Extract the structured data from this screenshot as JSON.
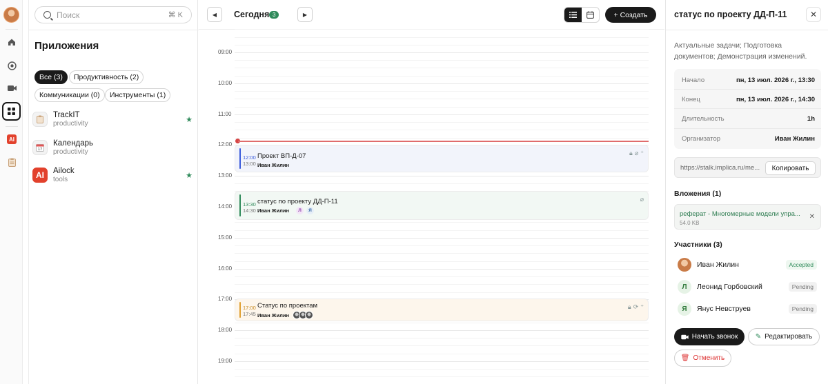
{
  "search": {
    "placeholder": "Поиск",
    "shortcut": "⌘ K"
  },
  "apps": {
    "title": "Приложения",
    "filters": [
      "Все (3)",
      "Продуктивность (2)",
      "Коммуникации (0)",
      "Инструменты (1)"
    ],
    "items": [
      {
        "name": "TrackIT",
        "category": "productivity",
        "icon": "clipboard-icon",
        "starred": true
      },
      {
        "name": "Календарь",
        "category": "productivity",
        "icon": "calendar-icon",
        "starred": false
      },
      {
        "name": "Ailock",
        "category": "tools",
        "icon": "ai-logo-icon",
        "starred": true
      }
    ]
  },
  "calendar": {
    "day_label": "Сегодня",
    "count": "3",
    "create_label": "+ Создать",
    "hours": [
      "09:00",
      "10:00",
      "11:00",
      "12:00",
      "13:00",
      "14:00",
      "15:00",
      "16:00",
      "17:00",
      "18:00",
      "19:00"
    ],
    "events": [
      {
        "start": "12:00",
        "end": "13:00",
        "title": "Проект ВП-Д-07",
        "organizer": "Иван Жилин",
        "color": "#3b5bdb"
      },
      {
        "start": "13:30",
        "end": "14:30",
        "title": "статус по проекту ДД-П-11",
        "organizer": "Иван Жилин",
        "participants": [
          "Л",
          "Я"
        ],
        "color": "#2f8a5a"
      },
      {
        "start": "17:00",
        "end": "17:45",
        "title": "Статус по проектам",
        "organizer": "Иван Жилин",
        "color": "#e0a030"
      }
    ]
  },
  "details": {
    "title": "статус по проекту ДД-П-11",
    "description": "Актуальные задачи; Подготовка документов; Демонстрация изменений.",
    "rows": [
      {
        "k": "Начало",
        "v": "пн, 13 июл. 2026 г., 13:30"
      },
      {
        "k": "Конец",
        "v": "пн, 13 июл. 2026 г., 14:30"
      },
      {
        "k": "Длительность",
        "v": "1h"
      },
      {
        "k": "Организатор",
        "v": "Иван Жилин"
      }
    ],
    "link": "https://stalk.implica.ru/me...",
    "copy_label": "Копировать",
    "attachments_title": "Вложения (1)",
    "attachment": {
      "name": "реферат - Многомерные модели упра...",
      "size": "54.0 KB"
    },
    "participants_title": "Участники (3)",
    "participants": [
      {
        "name": "Иван Жилин",
        "initial": "",
        "status": "Accepted"
      },
      {
        "name": "Леонид Горбовский",
        "initial": "Л",
        "status": "Pending"
      },
      {
        "name": "Янус Невструев",
        "initial": "Я",
        "status": "Pending"
      }
    ],
    "actions": {
      "call": "Начать звонок",
      "edit": "Редактировать",
      "cancel": "Отменить"
    }
  }
}
